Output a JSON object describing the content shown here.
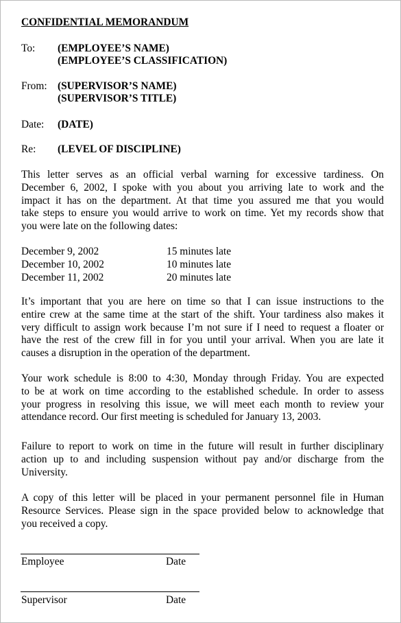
{
  "memo": {
    "title": "CONFIDENTIAL MEMORANDUM",
    "header": {
      "to_label": "To:",
      "to_lines": [
        "(EMPLOYEE’S NAME)",
        "(EMPLOYEE’S CLASSIFICATION)"
      ],
      "from_label": "From:",
      "from_lines": [
        "(SUPERVISOR’S NAME)",
        "(SUPERVISOR’S TITLE)"
      ],
      "date_label": "Date:",
      "date_value": "(DATE)",
      "re_label": "Re:",
      "re_value": "(LEVEL OF DISCIPLINE)"
    },
    "paragraphs": {
      "intro": [
        "This letter serves as an official verbal warning for excessive tardiness.  On",
        "December 6, 2002, I spoke with you about you arriving late to work and the",
        "impact it has on the department.  At that time you assured me that you would",
        "take steps to ensure you would arrive to work on time.  Yet my records show that",
        "you were late on the following dates:"
      ],
      "importance": [
        "It’s important that you are here on time so that I can issue instructions to the",
        "entire crew at the same time at the start of the shift.  Your tardiness also makes it",
        "very difficult to assign work because I’m not sure if I need to request a floater or",
        "have the rest of the crew fill in for you until your arrival.  When you are late it",
        "causes a disruption in the operation of the department."
      ],
      "schedule": [
        "Your work schedule is 8:00 to 4:30, Monday through Friday.  You are expected",
        "to be at work on time according to the established schedule.  In order to assess",
        "your progress in resolving this issue, we will meet each month to review your",
        "attendance record.  Our first meeting is scheduled for January 13, 2003."
      ],
      "failure": [
        "Failure to report to work on time in the future will result in further disciplinary",
        "action up to and including suspension without pay and/or discharge from the",
        "University."
      ],
      "copy": [
        "A copy of this letter will be placed in your permanent personnel file in Human",
        "Resource Services.  Please sign in the space provided below to acknowledge that",
        "you received a copy."
      ]
    },
    "tardiness_records": [
      {
        "date": "December 9, 2002",
        "duration": "15 minutes late"
      },
      {
        "date": "December 10, 2002",
        "duration": "10 minutes late"
      },
      {
        "date": "December 11, 2002",
        "duration": "20 minutes late"
      }
    ],
    "signatures": [
      {
        "label": "Employee",
        "date_label": "Date"
      },
      {
        "label": "Supervisor",
        "date_label": "Date"
      }
    ]
  }
}
